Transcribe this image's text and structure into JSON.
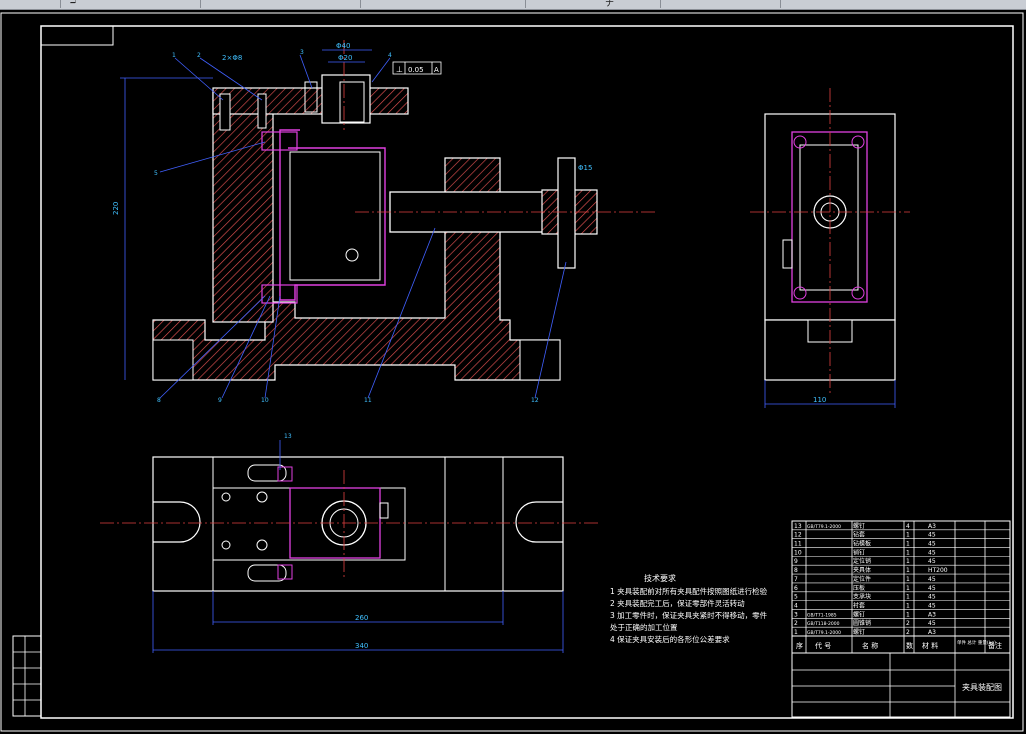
{
  "toolbar": {
    "item_a": "ℶ",
    "item_b": "ナ"
  },
  "dims": {
    "d1": "2×Φ8",
    "d2": "Φ40",
    "d3": "Φ20",
    "d4": "0.05",
    "d5": "A",
    "d6": "220",
    "d7": "Φ15",
    "d8": "110",
    "d9": "260",
    "d10": "340"
  },
  "labels": {
    "l1": "1",
    "l2": "2",
    "l3": "3",
    "l4": "4",
    "l5": "5",
    "l6": "6",
    "l7": "7",
    "l8": "8",
    "l9": "9",
    "l10": "10",
    "l11": "11",
    "l12": "12",
    "l13": "13"
  },
  "tech": {
    "title": "技术要求",
    "items": [
      "1  夹具装配前对所有夹具配件按照图纸进行检验",
      "2  夹具装配完工后，保证零部件灵活转动",
      "3  加工零件时，保证夹具夹紧时不得移动，零件",
      "    处于正确的加工位置",
      "4  保证夹具安装后的各形位公差要求"
    ]
  },
  "bom": {
    "rows": [
      {
        "no": "13",
        "code": "GB/T79.1-2000",
        "name": "螺钉",
        "qty": "4",
        "mat": "A3"
      },
      {
        "no": "12",
        "code": "",
        "name": "钻套",
        "qty": "1",
        "mat": "45"
      },
      {
        "no": "11",
        "code": "",
        "name": "钻模板",
        "qty": "1",
        "mat": "45"
      },
      {
        "no": "10",
        "code": "",
        "name": "销钉",
        "qty": "1",
        "mat": "45"
      },
      {
        "no": "9",
        "code": "",
        "name": "定位销",
        "qty": "1",
        "mat": "45"
      },
      {
        "no": "8",
        "code": "",
        "name": "夹具体",
        "qty": "1",
        "mat": "HT200"
      },
      {
        "no": "7",
        "code": "",
        "name": "定位件",
        "qty": "1",
        "mat": "45"
      },
      {
        "no": "6",
        "code": "",
        "name": "压板",
        "qty": "1",
        "mat": "45"
      },
      {
        "no": "5",
        "code": "",
        "name": "支承块",
        "qty": "1",
        "mat": "45"
      },
      {
        "no": "4",
        "code": "",
        "name": "衬套",
        "qty": "1",
        "mat": "45"
      },
      {
        "no": "3",
        "code": "GB/T71-1985",
        "name": "螺钉",
        "qty": "1",
        "mat": "A3"
      },
      {
        "no": "2",
        "code": "GB/T118-2000",
        "name": "圆锥销",
        "qty": "2",
        "mat": "45"
      },
      {
        "no": "1",
        "code": "GB/T79.1-2000",
        "name": "螺钉",
        "qty": "2",
        "mat": "A3"
      }
    ],
    "header": {
      "seq": "序",
      "code": "代  号",
      "name": "名  称",
      "qty": "数",
      "mat": "材  料",
      "weight": "单件 总计\n重量(kg)",
      "note": "备注"
    },
    "title_block": "夹具装配图"
  }
}
